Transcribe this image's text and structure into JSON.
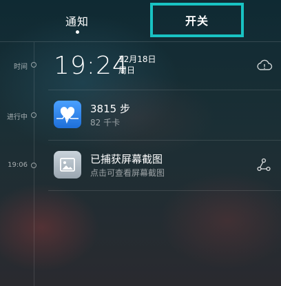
{
  "tabs": {
    "notify": "通知",
    "switch": "开关"
  },
  "timeline": {
    "time_label": "时间",
    "ongoing_label": "进行中",
    "screenshot_time": "19:06"
  },
  "clock": {
    "time": "19:24",
    "date": "12月18日",
    "weekday": "周日"
  },
  "health": {
    "steps": "3815 步",
    "calories": "82 千卡"
  },
  "screenshot": {
    "title": "已捕获屏幕截图",
    "subtitle": "点击可查看屏幕截图"
  },
  "colors": {
    "highlight_border": "#19c3c3",
    "health_icon": "#2f86f0"
  },
  "icons": {
    "cloud": "cloud-alert-icon",
    "share": "share-icon",
    "health": "heart-pulse-icon",
    "image": "image-icon"
  }
}
